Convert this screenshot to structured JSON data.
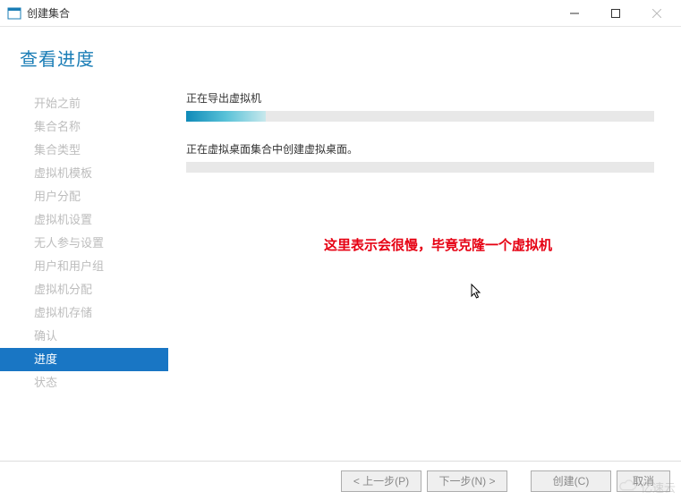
{
  "window": {
    "title": "创建集合"
  },
  "header": {
    "title": "查看进度"
  },
  "sidebar": {
    "items": [
      {
        "label": "开始之前"
      },
      {
        "label": "集合名称"
      },
      {
        "label": "集合类型"
      },
      {
        "label": "虚拟机模板"
      },
      {
        "label": "用户分配"
      },
      {
        "label": "虚拟机设置"
      },
      {
        "label": "无人参与设置"
      },
      {
        "label": "用户和用户组"
      },
      {
        "label": "虚拟机分配"
      },
      {
        "label": "虚拟机存储"
      },
      {
        "label": "确认"
      },
      {
        "label": "进度"
      },
      {
        "label": "状态"
      }
    ],
    "active_index": 11
  },
  "main": {
    "tasks": [
      {
        "label": "正在导出虚拟机",
        "progress": 17
      },
      {
        "label": "正在虚拟桌面集合中创建虚拟桌面。",
        "progress": 0
      }
    ],
    "annotation": "这里表示会很慢，毕竟克隆一个虚拟机"
  },
  "footer": {
    "prev": "< 上一步(P)",
    "next": "下一步(N) >",
    "create": "创建(C)",
    "cancel": "取消"
  },
  "watermark": {
    "text": "亿速云"
  }
}
